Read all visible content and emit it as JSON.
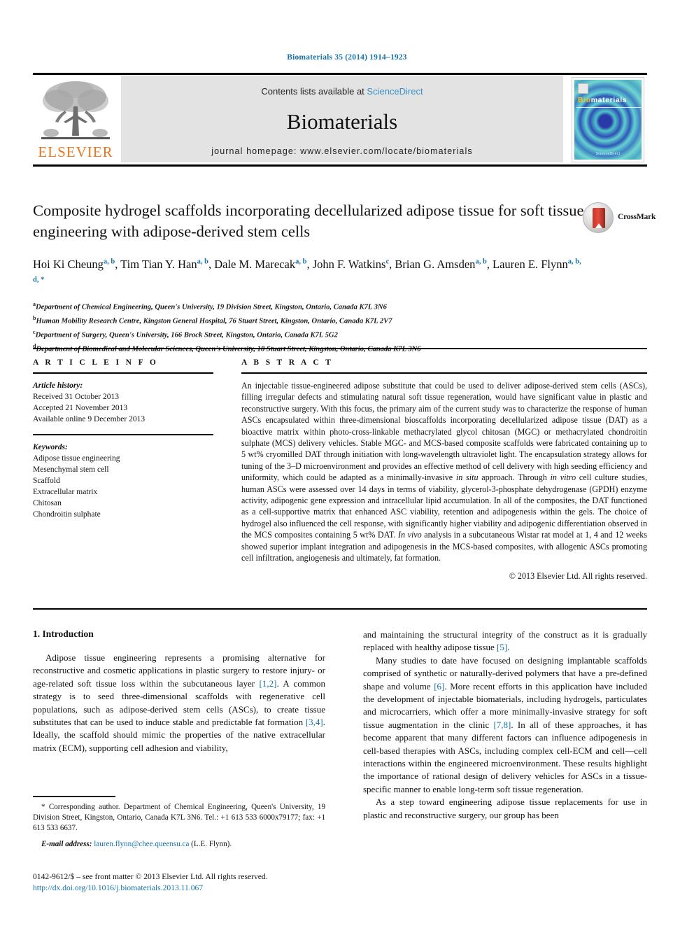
{
  "running_head": "Biomaterials 35 (2014) 1914–1923",
  "masthead": {
    "publisher_logo_text": "ELSEVIER",
    "contents_prefix": "Contents lists available at ",
    "contents_link": "ScienceDirect",
    "journal_name": "Biomaterials",
    "homepage": "journal homepage: www.elsevier.com/locate/biomaterials",
    "cover": {
      "title_first": "Bio",
      "title_rest": "materials",
      "footer_text": "ScienceDirect"
    }
  },
  "article": {
    "title": "Composite hydrogel scaffolds incorporating decellularized adipose tissue for soft tissue engineering with adipose-derived stem cells",
    "crossmark_label": "CrossMark",
    "authors": [
      {
        "name": "Hoi Ki Cheung",
        "marks": "a, b",
        "sep": ", "
      },
      {
        "name": "Tim Tian Y. Han",
        "marks": "a, b",
        "sep": ", "
      },
      {
        "name": "Dale M. Marecak",
        "marks": "a, b",
        "sep": ", "
      },
      {
        "name": "John F. Watkins",
        "marks": "c",
        "sep": ", "
      },
      {
        "name": "Brian G. Amsden",
        "marks": "a, b",
        "sep": ", "
      },
      {
        "name": "Lauren E. Flynn",
        "marks": "a, b, d, *",
        "sep": ""
      }
    ],
    "affiliations": [
      {
        "mark": "a",
        "text": "Department of Chemical Engineering, Queen's University, 19 Division Street, Kingston, Ontario, Canada K7L 3N6"
      },
      {
        "mark": "b",
        "text": "Human Mobility Research Centre, Kingston General Hospital, 76 Stuart Street, Kingston, Ontario, Canada K7L 2V7"
      },
      {
        "mark": "c",
        "text": "Department of Surgery, Queen's University, 166 Brock Street, Kingston, Ontario, Canada K7L 5G2"
      },
      {
        "mark": "d",
        "text": "Department of Biomedical and Molecular Sciences, Queen's University, 18 Stuart Street, Kingston, Ontario, Canada K7L 3N6"
      }
    ]
  },
  "article_info": {
    "heading": "A R T I C L E  I N F O",
    "history_label": "Article history:",
    "history": [
      "Received 31 October 2013",
      "Accepted 21 November 2013",
      "Available online 9 December 2013"
    ],
    "keywords_label": "Keywords:",
    "keywords": [
      "Adipose tissue engineering",
      "Mesenchymal stem cell",
      "Scaffold",
      "Extracellular matrix",
      "Chitosan",
      "Chondroitin sulphate"
    ]
  },
  "abstract": {
    "heading": "A B S T R A C T",
    "text": "An injectable tissue-engineered adipose substitute that could be used to deliver adipose-derived stem cells (ASCs), filling irregular defects and stimulating natural soft tissue regeneration, would have significant value in plastic and reconstructive surgery. With this focus, the primary aim of the current study was to characterize the response of human ASCs encapsulated within three-dimensional bioscaffolds incorporating decellularized adipose tissue (DAT) as a bioactive matrix within photo-cross-linkable methacrylated glycol chitosan (MGC) or methacrylated chondroitin sulphate (MCS) delivery vehicles. Stable MGC- and MCS-based composite scaffolds were fabricated containing up to 5 wt% cryomilled DAT through initiation with long-wavelength ultraviolet light. The encapsulation strategy allows for tuning of the 3–D microenvironment and provides an effective method of cell delivery with high seeding efficiency and uniformity, which could be adapted as a minimally-invasive ",
    "italic_1": "in situ",
    "text_2": " approach. Through ",
    "italic_2": "in vitro",
    "text_3": " cell culture studies, human ASCs were assessed over 14 days in terms of viability, glycerol-3-phosphate dehydrogenase (GPDH) enzyme activity, adipogenic gene expression and intracellular lipid accumulation. In all of the composites, the DAT functioned as a cell-supportive matrix that enhanced ASC viability, retention and adipogenesis within the gels. The choice of hydrogel also influenced the cell response, with significantly higher viability and adipogenic differentiation observed in the MCS composites containing 5 wt% DAT. ",
    "italic_3": "In vivo",
    "text_4": " analysis in a subcutaneous Wistar rat model at 1, 4 and 12 weeks showed superior implant integration and adipogenesis in the MCS-based composites, with allogenic ASCs promoting cell infiltration, angiogenesis and ultimately, fat formation.",
    "copyright": "© 2013 Elsevier Ltd. All rights reserved."
  },
  "introduction": {
    "heading": "1.  Introduction",
    "left_p1_a": "Adipose tissue engineering represents a promising alternative for reconstructive and cosmetic applications in plastic surgery to restore injury- or age-related soft tissue loss within the subcutaneous layer ",
    "left_p1_ref1": "[1,2]",
    "left_p1_b": ". A common strategy is to seed three-dimensional scaffolds with regenerative cell populations, such as adipose-derived stem cells (ASCs), to create tissue substitutes that can be used to induce stable and predictable fat formation ",
    "left_p1_ref2": "[3,4]",
    "left_p1_c": ". Ideally, the scaffold should mimic the properties of the native extracellular matrix (ECM), supporting cell adhesion and viability,",
    "right_p0_a": "and maintaining the structural integrity of the construct as it is gradually replaced with healthy adipose tissue ",
    "right_p0_ref": "[5]",
    "right_p0_b": ".",
    "right_p1_a": "Many studies to date have focused on designing implantable scaffolds comprised of synthetic or naturally-derived polymers that have a pre-defined shape and volume ",
    "right_p1_ref1": "[6]",
    "right_p1_b": ". More recent efforts in this application have included the development of injectable biomaterials, including hydrogels, particulates and microcarriers, which offer a more minimally-invasive strategy for soft tissue augmentation in the clinic ",
    "right_p1_ref2": "[7,8]",
    "right_p1_c": ". In all of these approaches, it has become apparent that many different factors can influence adipogenesis in cell-based therapies with ASCs, including complex cell-ECM and cell—cell interactions within the engineered microenvironment. These results highlight the importance of rational design of delivery vehicles for ASCs in a tissue-specific manner to enable long-term soft tissue regeneration.",
    "right_p2": "As a step toward engineering adipose tissue replacements for use in plastic and reconstructive surgery, our group has been"
  },
  "footnote": {
    "corresponding": "* Corresponding author. Department of Chemical Engineering, Queen's University, 19 Division Street, Kingston, Ontario, Canada K7L 3N6. Tel.: +1 613 533 6000x79177; fax: +1 613 533 6637.",
    "email_label": "E-mail address:",
    "email": "lauren.flynn@chee.queensu.ca",
    "email_suffix": " (L.E. Flynn)."
  },
  "footer": {
    "issn_line": "0142-9612/$ – see front matter © 2013 Elsevier Ltd. All rights reserved.",
    "doi": "http://dx.doi.org/10.1016/j.biomaterials.2013.11.067"
  }
}
